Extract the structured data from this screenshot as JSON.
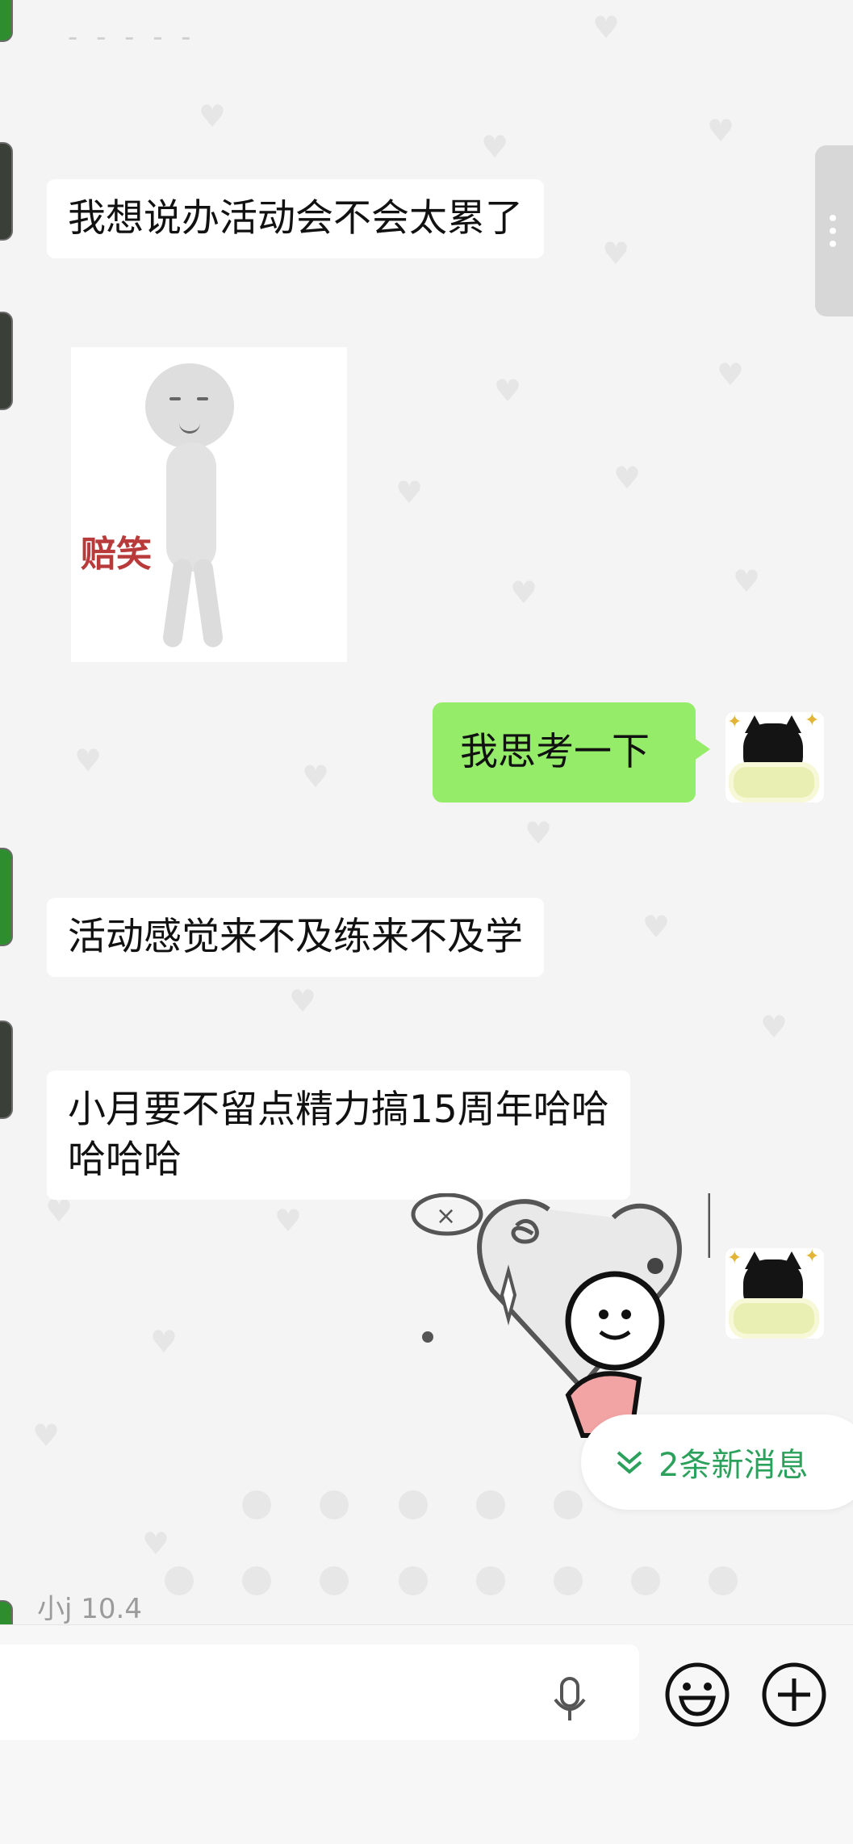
{
  "messages": {
    "m1_text": "我想说办活动会不会太累了",
    "m2_sticker_caption": "赔笑",
    "m3_text": "我思考一下",
    "m4_text": "活动感觉来不及练来不及学",
    "m5_text_line1": "小月要不留点精力搞15周年哈哈",
    "m5_text_line2": "哈哈哈"
  },
  "new_messages_pill": {
    "label": "2条新消息"
  },
  "last_sender": {
    "name_and_date": "小j 10.4"
  },
  "input_bar": {
    "placeholder": ""
  },
  "colors": {
    "outgoing_bubble": "#95ec69",
    "incoming_bubble": "#ffffff",
    "pill_text": "#2ca15c",
    "background": "#f4f4f4"
  },
  "icons": [
    "mic-icon",
    "emoji-icon",
    "plus-icon",
    "chevron-double-down-icon",
    "more-vertical-icon"
  ]
}
